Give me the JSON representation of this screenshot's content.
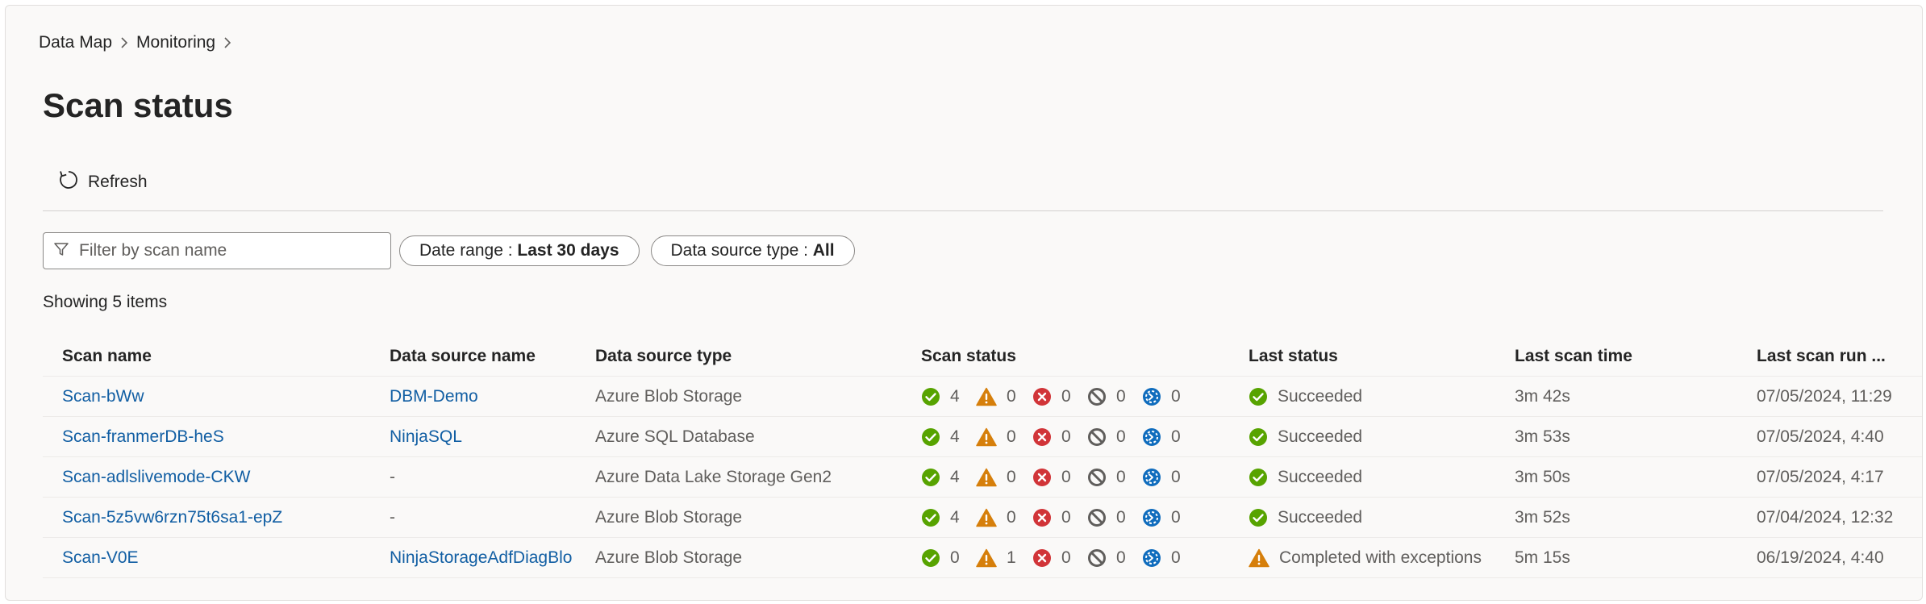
{
  "breadcrumb": {
    "items": [
      "Data Map",
      "Monitoring"
    ]
  },
  "page": {
    "title": "Scan status"
  },
  "toolbar": {
    "refresh_label": "Refresh"
  },
  "filters": {
    "search_placeholder": "Filter by scan name",
    "date_range": {
      "label": "Date range : ",
      "value": "Last 30 days"
    },
    "source_type": {
      "label": "Data source type : ",
      "value": "All"
    }
  },
  "summary": {
    "showing": "Showing 5 items"
  },
  "colors": {
    "success": "#57a300",
    "warning": "#d67f0b",
    "error": "#d13438",
    "cancelled": "#605e5c",
    "queued": "#0f6cbd",
    "link": "#115ea3"
  },
  "table": {
    "columns": [
      "Scan name",
      "Data source name",
      "Data source type",
      "Scan status",
      "Last status",
      "Last scan time",
      "Last scan run ..."
    ],
    "rows": [
      {
        "scan_name": "Scan-bWw",
        "data_source_name": "DBM-Demo",
        "data_source_type": "Azure Blob Storage",
        "counts": {
          "succeeded": "4",
          "warning": "0",
          "failed": "0",
          "cancelled": "0",
          "queued": "0"
        },
        "last_status": "Succeeded",
        "last_status_icon": "success-icon",
        "last_scan_time": "3m 42s",
        "last_scan_run": "07/05/2024, 11:29"
      },
      {
        "scan_name": "Scan-franmerDB-heS",
        "data_source_name": "NinjaSQL",
        "data_source_type": "Azure SQL Database",
        "counts": {
          "succeeded": "4",
          "warning": "0",
          "failed": "0",
          "cancelled": "0",
          "queued": "0"
        },
        "last_status": "Succeeded",
        "last_status_icon": "success-icon",
        "last_scan_time": "3m 53s",
        "last_scan_run": "07/05/2024, 4:40"
      },
      {
        "scan_name": "Scan-adlslivemode-CKW",
        "data_source_name": "-",
        "data_source_type": "Azure Data Lake Storage Gen2",
        "counts": {
          "succeeded": "4",
          "warning": "0",
          "failed": "0",
          "cancelled": "0",
          "queued": "0"
        },
        "last_status": "Succeeded",
        "last_status_icon": "success-icon",
        "last_scan_time": "3m 50s",
        "last_scan_run": "07/05/2024, 4:17"
      },
      {
        "scan_name": "Scan-5z5vw6rzn75t6sa1-epZ",
        "data_source_name": "-",
        "data_source_type": "Azure Blob Storage",
        "counts": {
          "succeeded": "4",
          "warning": "0",
          "failed": "0",
          "cancelled": "0",
          "queued": "0"
        },
        "last_status": "Succeeded",
        "last_status_icon": "success-icon",
        "last_scan_time": "3m 52s",
        "last_scan_run": "07/04/2024, 12:32"
      },
      {
        "scan_name": "Scan-V0E",
        "data_source_name": "NinjaStorageAdfDiagBlo",
        "data_source_type": "Azure Blob Storage",
        "counts": {
          "succeeded": "0",
          "warning": "1",
          "failed": "0",
          "cancelled": "0",
          "queued": "0"
        },
        "last_status": "Completed with exceptions",
        "last_status_icon": "warning-icon",
        "last_scan_time": "5m 15s",
        "last_scan_run": "06/19/2024, 4:40"
      }
    ]
  }
}
